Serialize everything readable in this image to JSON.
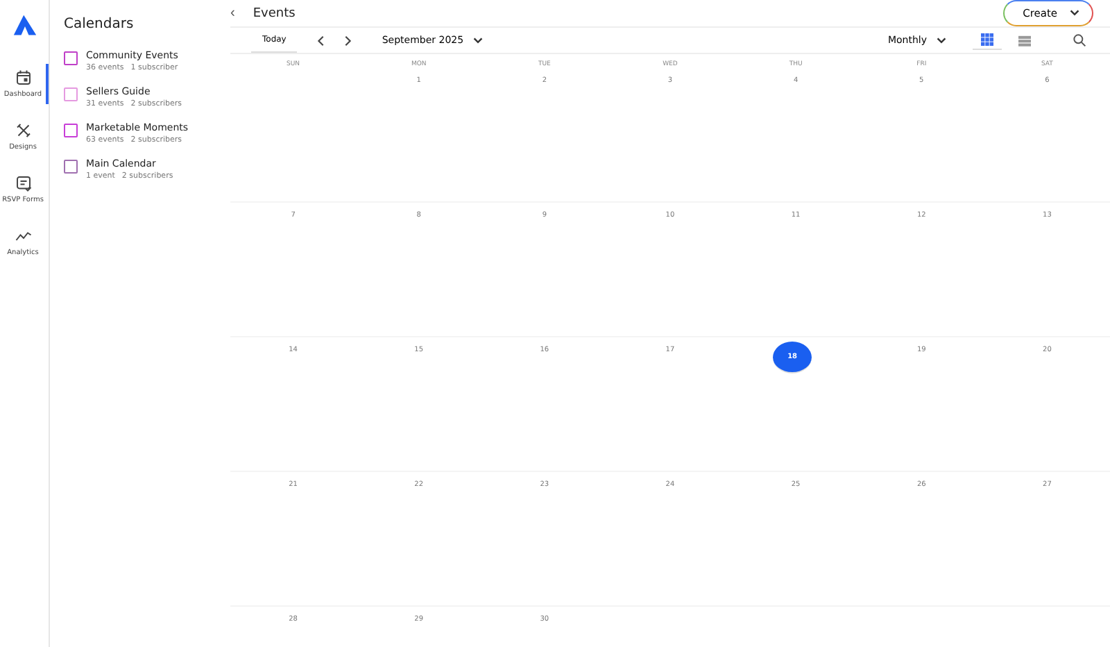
{
  "nav": {
    "items": [
      {
        "label": "Dashboard",
        "kind": "calendar",
        "selected": true
      },
      {
        "label": "Designs",
        "kind": "tools",
        "selected": false
      },
      {
        "label": "RSVP Forms",
        "kind": "form",
        "selected": false
      },
      {
        "label": "Analytics",
        "kind": "chart",
        "selected": false
      }
    ]
  },
  "sidebar": {
    "title": "Calendars",
    "calendars": [
      {
        "name": "Community Events",
        "events": "36 events",
        "subscribers": "1 subscriber",
        "checked": false,
        "color": "#c040c8"
      },
      {
        "name": "Sellers Guide",
        "events": "31 events",
        "subscribers": "2 subscribers",
        "checked": false,
        "color": "#e59ae0"
      },
      {
        "name": "Marketable Moments",
        "events": "63 events",
        "subscribers": "2 subscribers",
        "checked": false,
        "color": "#c83ed8"
      },
      {
        "name": "Main Calendar",
        "events": "1 event",
        "subscribers": "2 subscribers",
        "checked": false,
        "color": "#a070b0"
      }
    ]
  },
  "header": {
    "collapse": "‹",
    "title": "Events",
    "create_button": "Create"
  },
  "toolbar": {
    "today": "Today",
    "month": "September 2025",
    "view": "Monthly",
    "views": [
      {
        "kind": "grid",
        "selected": true
      },
      {
        "kind": "list",
        "selected": false
      }
    ]
  },
  "calendar": {
    "weekdays": [
      "SUN",
      "MON",
      "TUE",
      "WED",
      "THU",
      "FRI",
      "SAT"
    ],
    "weeks": [
      {
        "days": [
          {
            "day": "1",
            "today": false
          },
          {
            "day": "2",
            "today": false
          },
          {
            "day": "3",
            "today": false
          },
          {
            "day": "4",
            "today": false
          },
          {
            "day": "5",
            "today": false
          },
          {
            "day": "6",
            "today": false
          }
        ]
      },
      {
        "days": [
          {
            "day": "7",
            "today": false
          },
          {
            "day": "8",
            "today": false
          },
          {
            "day": "9",
            "today": false
          },
          {
            "day": "10",
            "today": false
          },
          {
            "day": "11",
            "today": false
          },
          {
            "day": "12",
            "today": false
          },
          {
            "day": "13",
            "today": false
          }
        ]
      },
      {
        "days": [
          {
            "day": "14",
            "today": false
          },
          {
            "day": "15",
            "today": false
          },
          {
            "day": "16",
            "today": false
          },
          {
            "day": "17",
            "today": false
          },
          {
            "day": "18",
            "today": true
          },
          {
            "day": "19",
            "today": false
          },
          {
            "day": "20",
            "today": false
          }
        ]
      },
      {
        "days": [
          {
            "day": "21",
            "today": false
          },
          {
            "day": "22",
            "today": false
          },
          {
            "day": "23",
            "today": false
          },
          {
            "day": "24",
            "today": false
          },
          {
            "day": "25",
            "today": false
          },
          {
            "day": "26",
            "today": false
          },
          {
            "day": "27",
            "today": false
          }
        ]
      },
      {
        "days": [
          {
            "day": "28",
            "today": false
          },
          {
            "day": "29",
            "today": false
          },
          {
            "day": "30",
            "today": false
          }
        ]
      }
    ]
  }
}
